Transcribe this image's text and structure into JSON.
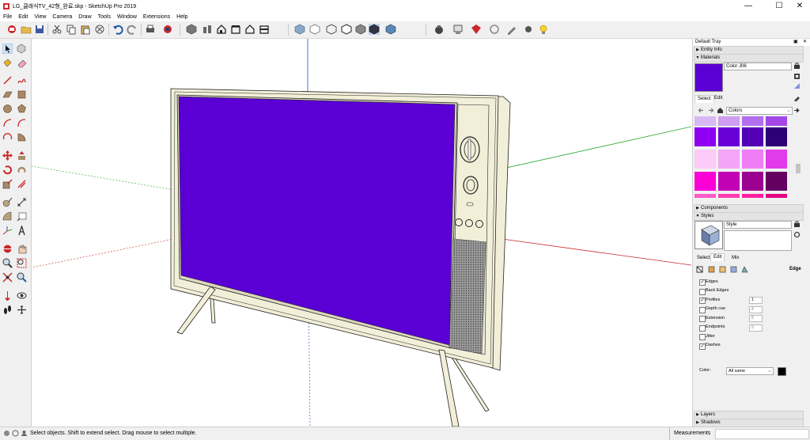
{
  "window": {
    "title": "LG_클래식TV_42형_완료.skp - SketchUp Pro 2019",
    "min_glyph": "—",
    "max_glyph": "☐",
    "close_glyph": "✕"
  },
  "menu": [
    "File",
    "Edit",
    "View",
    "Camera",
    "Draw",
    "Tools",
    "Window",
    "Extensions",
    "Help"
  ],
  "tray": {
    "title": "Default Tray",
    "pin_glyph": "▣",
    "close_glyph": "✕",
    "sections": {
      "entity_info": "Entity Info",
      "materials": "Materials",
      "components": "Components",
      "styles": "Styles",
      "layers": "Layers",
      "shadows": "Shadows"
    },
    "materials": {
      "name_value": "Color J06",
      "current_color": "#5a00d4",
      "tabs": [
        "Select",
        "Edit"
      ],
      "library": "Colors",
      "swatches": [
        "#d7b8f5",
        "#cf9cf0",
        "#b36ef0",
        "#a347e8",
        "#8f00f2",
        "#6a00d8",
        "#5400b6",
        "#2e0078",
        "#fccaf7",
        "#f4a5f7",
        "#ef7ef5",
        "#e23be9",
        "#fb00d7",
        "#c200b4",
        "#9b0090",
        "#640060",
        "#ff5ac8",
        "#ff3cb4",
        "#ff1fa0",
        "#e60082"
      ]
    },
    "styles": {
      "name_value": "Style",
      "tabs": [
        "Select",
        "Edit",
        "Mix"
      ],
      "edge_label": "Edge",
      "options": [
        {
          "label": "Edges",
          "checked": true,
          "value": ""
        },
        {
          "label": "Back Edges",
          "checked": false,
          "value": ""
        },
        {
          "label": "Profiles",
          "checked": true,
          "value": "1"
        },
        {
          "label": "Depth cue",
          "checked": false,
          "value": "4"
        },
        {
          "label": "Extension",
          "checked": false,
          "value": "8"
        },
        {
          "label": "Endpoints",
          "checked": false,
          "value": "5"
        },
        {
          "label": "Jitter",
          "checked": false,
          "value": ""
        },
        {
          "label": "Dashes",
          "checked": true,
          "value": ""
        }
      ],
      "color_label": "Color:",
      "color_value": "All same",
      "color_swatch": "#000000"
    }
  },
  "model": {
    "screen_color": "#5a00d4",
    "body_color": "#f2efd9"
  },
  "status": {
    "hint": "Select objects. Shift to extend select. Drag mouse to select multiple.",
    "measurements_label": "Measurements"
  }
}
